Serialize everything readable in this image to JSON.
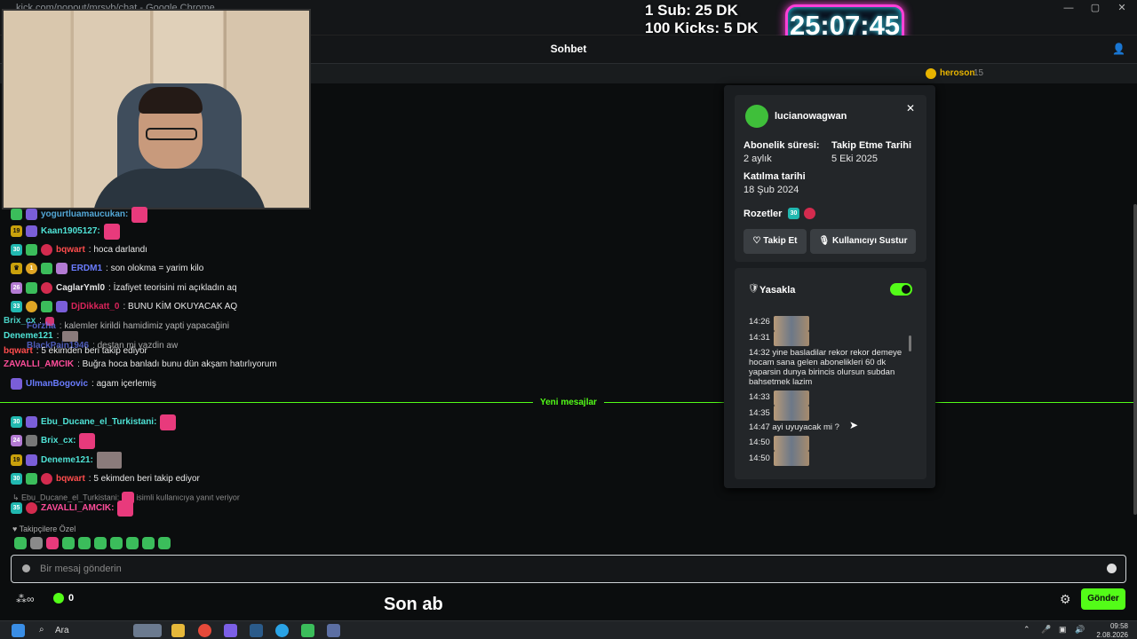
{
  "browser": {
    "title": "kick.com/popout/mrsyb/chat - Google Chrome"
  },
  "overlay": {
    "sub_line1": "1 Sub: 25 DK",
    "sub_line2": "100 Kicks: 5 DK",
    "timer": "25:07:45"
  },
  "chat": {
    "header_title": "Sohbet",
    "pinned": {
      "name": "heroson",
      "count": "15"
    },
    "messages_old": [
      {
        "user": "yogurtluamaucukan:",
        "text": "",
        "color": "#53a7d6"
      },
      {
        "user": "Kaan1905127:",
        "text": "",
        "color": "#4fe3d6"
      },
      {
        "user": "bqwart",
        "text": ": hoca darlandı",
        "color": "#ff4d4d"
      },
      {
        "user": "ERDM1",
        "text": ": son olokma = yarim kilo",
        "color": "#6a7cff"
      },
      {
        "user": "CaglarYml0",
        "text": ": İzafiyet teorisini mi açıkladın aq",
        "color": "#e8e8e8"
      },
      {
        "user": "DjDikkatt_0",
        "text": ": BUNU KİM OKUYACAK AQ",
        "color": "#d9245a"
      },
      {
        "user": "Brix_cx",
        "text": ":",
        "color": "#4fe3d6"
      },
      {
        "user": "Forzha",
        "text": ": kalemler kirildi hamidimiz yapti yapacağini",
        "color": "#6a7cff"
      },
      {
        "user": "Deneme121",
        "text": ":",
        "color": "#4fe3d6"
      },
      {
        "user": "BlackPain1946",
        "text": ": destan mi yazdin aw",
        "color": "#6a7cff"
      },
      {
        "user": "bqwart",
        "text": ": 5 ekimden beri takip ediyor",
        "color": "#ff4d4d"
      },
      {
        "user": "ZAVALLI_AMCIK",
        "text": ": Buğra hoca banladı bunu dün akşam hatırlıyorum",
        "color": "#ff4d9a"
      },
      {
        "user": "UlmanBogovic",
        "text": ": agam içerlemiş",
        "color": "#6a7cff"
      }
    ],
    "new_messages_label": "Yeni mesajlar",
    "messages_new": [
      {
        "user": "Ebu_Ducane_el_Turkistani:",
        "text": "",
        "color": "#4fe3d6"
      },
      {
        "user": "Brix_cx:",
        "text": "",
        "color": "#4fe3d6"
      },
      {
        "user": "Deneme121:",
        "text": "",
        "color": "#4fe3d6"
      },
      {
        "user": "bqwart",
        "text": ": 5 ekimden beri takip ediyor",
        "color": "#ff4d4d"
      },
      {
        "user": "ZAVALLI_AMCIK:",
        "text": "",
        "color": "#ff4d9a"
      }
    ],
    "reply_context": "↳ Ebu_Ducane_el_Turkistani:",
    "reply_note": "isimli kullanıcıya yanıt veriyor",
    "followers_only": "♥ Takipçilere Özel",
    "input_placeholder": "Bir mesaj gönderin",
    "kicks_count": "0",
    "send_label": "Gönder",
    "caption": "Son ab"
  },
  "user_card": {
    "username": "lucianowagwan",
    "sub_label": "Abonelik süresi:",
    "sub_value": "2 aylık",
    "follow_date_label": "Takip Etme Tarihi",
    "follow_date_value": "5 Eki 2025",
    "join_label": "Katılma tarihi",
    "join_value": "18 Şub 2024",
    "badges_label": "Rozetler",
    "follow_button": "Takip Et",
    "mute_button": "Kullanıcıyı Sustur",
    "ban_label": "Yasakla",
    "history": [
      {
        "time": "14:26",
        "text": ""
      },
      {
        "time": "14:31",
        "text": ""
      },
      {
        "time": "14:32",
        "text": "yine basladilar rekor rekor demeye hocam sana gelen abonelikleri 60 dk yaparsin dunya birincis olursun subdan bahsetmek lazim"
      },
      {
        "time": "14:33",
        "text": ""
      },
      {
        "time": "14:35",
        "text": ""
      },
      {
        "time": "14:47",
        "text": "ayi uyuyacak mi ?"
      },
      {
        "time": "14:50",
        "text": ""
      },
      {
        "time": "14:50",
        "text": ""
      }
    ]
  },
  "taskbar": {
    "search": "Ara",
    "time": "09:58",
    "date": "2.08.2026"
  }
}
